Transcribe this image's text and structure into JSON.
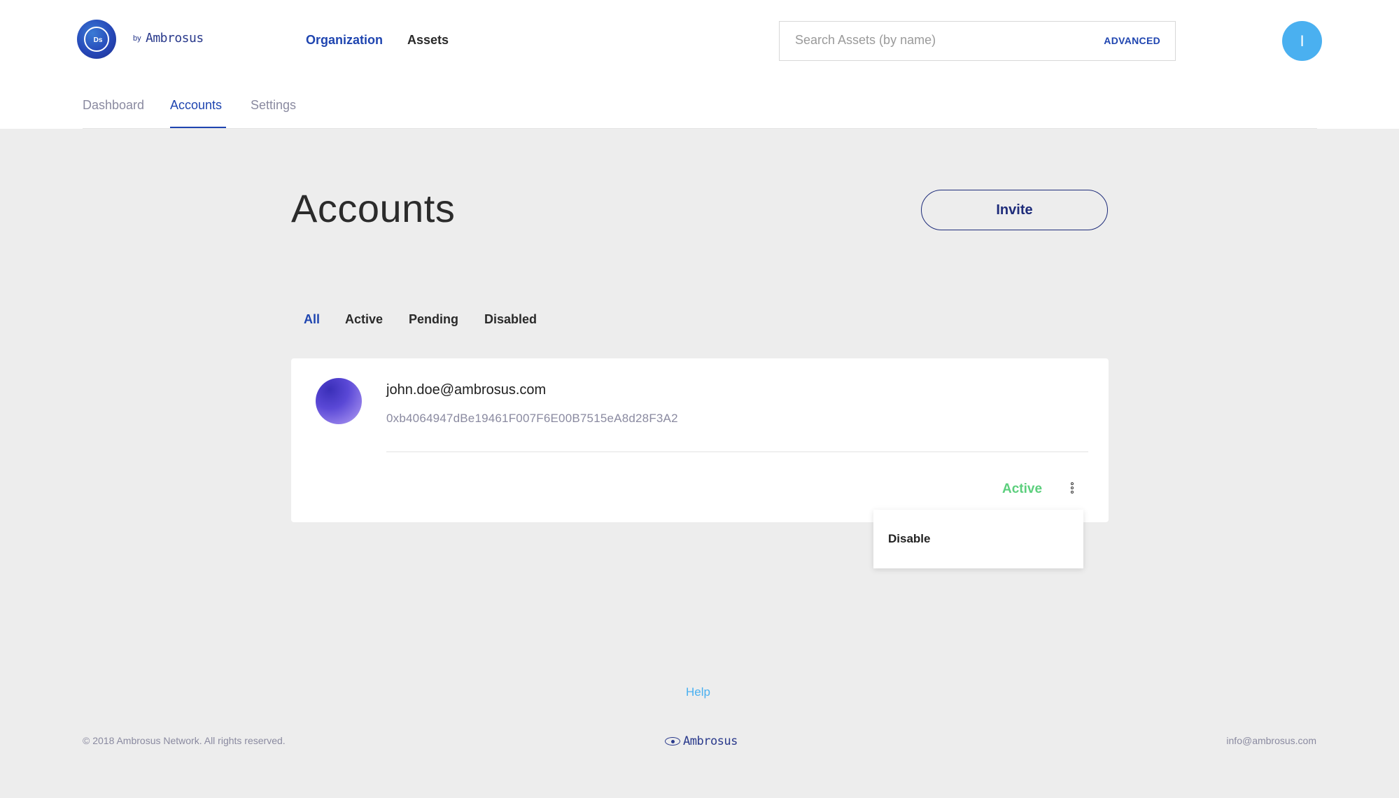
{
  "header": {
    "logo_text": "Ds",
    "by_text": "by",
    "brand_name": "Ambrosus",
    "nav": [
      {
        "label": "Organization",
        "active": true
      },
      {
        "label": "Assets",
        "active": false
      }
    ],
    "search": {
      "placeholder": "Search Assets (by name)",
      "value": "",
      "advanced_label": "ADVANCED"
    },
    "user_initial": "I"
  },
  "subnav": {
    "tabs": [
      {
        "label": "Dashboard",
        "active": false
      },
      {
        "label": "Accounts",
        "active": true
      },
      {
        "label": "Settings",
        "active": false
      }
    ]
  },
  "main": {
    "title": "Accounts",
    "invite_label": "Invite",
    "filters": [
      {
        "label": "All",
        "active": true
      },
      {
        "label": "Active",
        "active": false
      },
      {
        "label": "Pending",
        "active": false
      },
      {
        "label": "Disabled",
        "active": false
      }
    ],
    "accounts": [
      {
        "email": "john.doe@ambrosus.com",
        "address": "0xb4064947dBe19461F007F6E00B7515eA8d28F3A2",
        "status": "Active"
      }
    ],
    "menu": {
      "items": [
        {
          "label": "Disable"
        }
      ]
    }
  },
  "footer": {
    "help_label": "Help",
    "copyright": "© 2018 Ambrosus Network. All rights reserved.",
    "brand_name": "Ambrosus",
    "email": "info@ambrosus.com"
  },
  "colors": {
    "accent": "#1f45b0",
    "status_active": "#5ccf7d",
    "avatar_blue": "#4ab0f0",
    "background": "#ededed"
  },
  "icons": {
    "logo": "ds-logo-icon",
    "menu": "kebab-menu-icon",
    "footer_logo": "eye-icon"
  }
}
